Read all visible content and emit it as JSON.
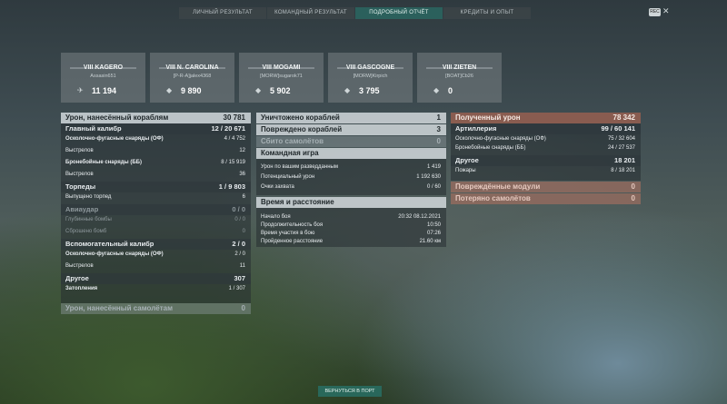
{
  "tabs": [
    "ЛИЧНЫЙ РЕЗУЛЬТАТ",
    "КОМАНДНЫЙ РЕЗУЛЬТАТ",
    "ПОДРОБНЫЙ ОТЧЁТ",
    "КРЕДИТЫ И ОПЫТ"
  ],
  "topbar": {
    "rec": "REC",
    "close": "✕"
  },
  "cards": [
    {
      "name": "VIII KAGERO",
      "player": "Assasin651",
      "score": "11 194"
    },
    {
      "name": "VIII N. CAROLINA",
      "player": "[P-R-A]jalex4368",
      "score": "9 890"
    },
    {
      "name": "VIII MOGAMI",
      "player": "[MORW]sugarok71",
      "score": "5 902"
    },
    {
      "name": "VIII GASCOGNE",
      "player": "[MORW]Kirpich",
      "score": "3 795"
    },
    {
      "name": "VIII ZIETEN",
      "player": "[BOAT]Cb26",
      "score": "0"
    }
  ],
  "left": {
    "damage": {
      "label": "Урон, нанесённый кораблям",
      "value": "30 781"
    },
    "main": {
      "label": "Главный калибр",
      "value": "12 / 20 671"
    },
    "he": {
      "label": "Осколочно-фугасные снаряды (ОФ)",
      "value": "4 / 4 752"
    },
    "shots1": {
      "label": "Выстрелов",
      "value": "12"
    },
    "ap": {
      "label": "Бронебойные снаряды (ББ)",
      "value": "8 / 15 919"
    },
    "shots2": {
      "label": "Выстрелов",
      "value": "36"
    },
    "torp": {
      "label": "Торпеды",
      "value": "1 / 9 803"
    },
    "torp_fired": {
      "label": "Выпущено торпед",
      "value": "6"
    },
    "air": {
      "label": "Авиаудар",
      "value": "0 / 0"
    },
    "depth": {
      "label": "Глубинные бомбы",
      "value": "0 / 0"
    },
    "dropped": {
      "label": "Сброшено бомб",
      "value": "0"
    },
    "secondary": {
      "label": "Вспомогательный калибр",
      "value": "2 / 0"
    },
    "sec_he": {
      "label": "Осколочно-фугасные снаряды (ОФ)",
      "value": "2 / 0"
    },
    "shots3": {
      "label": "Выстрелов",
      "value": "11"
    },
    "other": {
      "label": "Другое",
      "value": "307"
    },
    "flood": {
      "label": "Затопления",
      "value": "1 / 307"
    },
    "planes_dmg": {
      "label": "Урон, нанесённый самолётам",
      "value": "0"
    }
  },
  "middle": {
    "destroyed": {
      "label": "Уничтожено кораблей",
      "value": "1"
    },
    "damaged": {
      "label": "Повреждено кораблей",
      "value": "3"
    },
    "planes_down": {
      "label": "Сбито самолётов",
      "value": "0"
    },
    "team": {
      "label": "Командная игра"
    },
    "spot_dmg": {
      "label": "Урон по вашим разведданным",
      "value": "1 419"
    },
    "potential": {
      "label": "Потенциальный урон",
      "value": "1 192 630"
    },
    "capture": {
      "label": "Очки захвата",
      "value": "0 / 60"
    },
    "time": {
      "label": "Время и расстояние"
    },
    "start": {
      "label": "Начало боя",
      "value": "20:32  08.12.2021"
    },
    "duration": {
      "label": "Продолжительность боя",
      "value": "10:50"
    },
    "participation": {
      "label": "Время участия в бою",
      "value": "07:26"
    },
    "distance": {
      "label": "Пройденное расстояние",
      "value": "21.60 км"
    }
  },
  "right": {
    "received": {
      "label": "Полученный урон",
      "value": "78 342"
    },
    "artillery": {
      "label": "Артиллерия",
      "value": "99 / 60 141"
    },
    "he": {
      "label": "Осколочно-фугасные снаряды (ОФ)",
      "value": "75 / 32 604"
    },
    "ap": {
      "label": "Бронебойные снаряды (ББ)",
      "value": "24 / 27 537"
    },
    "other": {
      "label": "Другое",
      "value": "18 201"
    },
    "fires": {
      "label": "Пожары",
      "value": "8 / 18 201"
    },
    "modules": {
      "label": "Повреждённые модули",
      "value": "0"
    },
    "lost_planes": {
      "label": "Потеряно самолётов",
      "value": "0"
    }
  },
  "back_button": "ВЕРНУТЬСЯ В ПОРТ"
}
